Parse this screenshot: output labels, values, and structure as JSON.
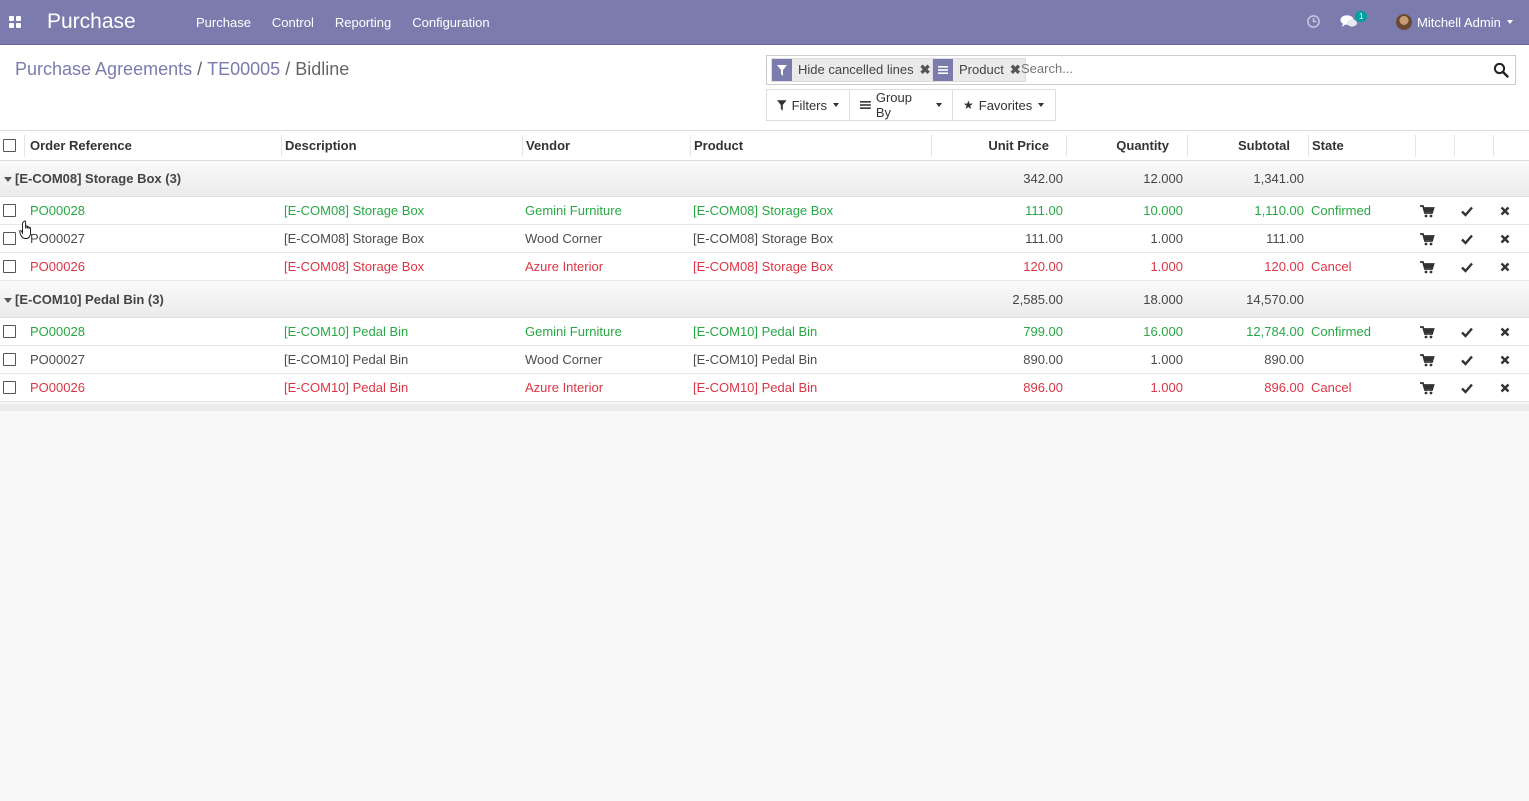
{
  "navbar": {
    "app_name": "Purchase",
    "menu": [
      "Purchase",
      "Control",
      "Reporting",
      "Configuration"
    ],
    "messages_count": "1",
    "user_name": "Mitchell Admin",
    "accent_color": "#7c7bad"
  },
  "breadcrumb": [
    "Purchase Agreements",
    "TE00005",
    "Bidline"
  ],
  "search": {
    "facets": [
      {
        "icon": "filter-icon",
        "label": "Hide cancelled lines"
      },
      {
        "icon": "group-by-icon",
        "label": "Product"
      }
    ],
    "placeholder": "Search..."
  },
  "buttons": {
    "filters": "Filters",
    "group_by": "Group By",
    "favorites": "Favorites"
  },
  "table": {
    "columns": [
      "Order Reference",
      "Description",
      "Vendor",
      "Product",
      "Unit Price",
      "Quantity",
      "Subtotal",
      "State"
    ],
    "groups": [
      {
        "label": "[E-COM08] Storage Box (3)",
        "unit_price": "342.00",
        "quantity": "12.000",
        "subtotal": "1,341.00",
        "rows": [
          {
            "ref": "PO00028",
            "desc": "[E-COM08] Storage Box",
            "vendor": "Gemini Furniture",
            "product": "[E-COM08] Storage Box",
            "price": "111.00",
            "qty": "10.000",
            "subtotal": "1,110.00",
            "state": "Confirmed",
            "tone": "green"
          },
          {
            "ref": "PO00027",
            "desc": "[E-COM08] Storage Box",
            "vendor": "Wood Corner",
            "product": "[E-COM08] Storage Box",
            "price": "111.00",
            "qty": "1.000",
            "subtotal": "111.00",
            "state": "",
            "tone": "dark"
          },
          {
            "ref": "PO00026",
            "desc": "[E-COM08] Storage Box",
            "vendor": "Azure Interior",
            "product": "[E-COM08] Storage Box",
            "price": "120.00",
            "qty": "1.000",
            "subtotal": "120.00",
            "state": "Cancel",
            "tone": "red"
          }
        ]
      },
      {
        "label": "[E-COM10] Pedal Bin (3)",
        "unit_price": "2,585.00",
        "quantity": "18.000",
        "subtotal": "14,570.00",
        "rows": [
          {
            "ref": "PO00028",
            "desc": "[E-COM10] Pedal Bin",
            "vendor": "Gemini Furniture",
            "product": "[E-COM10] Pedal Bin",
            "price": "799.00",
            "qty": "16.000",
            "subtotal": "12,784.00",
            "state": "Confirmed",
            "tone": "green"
          },
          {
            "ref": "PO00027",
            "desc": "[E-COM10] Pedal Bin",
            "vendor": "Wood Corner",
            "product": "[E-COM10] Pedal Bin",
            "price": "890.00",
            "qty": "1.000",
            "subtotal": "890.00",
            "state": "",
            "tone": "dark"
          },
          {
            "ref": "PO00026",
            "desc": "[E-COM10] Pedal Bin",
            "vendor": "Azure Interior",
            "product": "[E-COM10] Pedal Bin",
            "price": "896.00",
            "qty": "1.000",
            "subtotal": "896.00",
            "state": "Cancel",
            "tone": "red"
          }
        ]
      }
    ],
    "row_actions": [
      "cart-icon",
      "check-icon",
      "close-icon"
    ]
  }
}
